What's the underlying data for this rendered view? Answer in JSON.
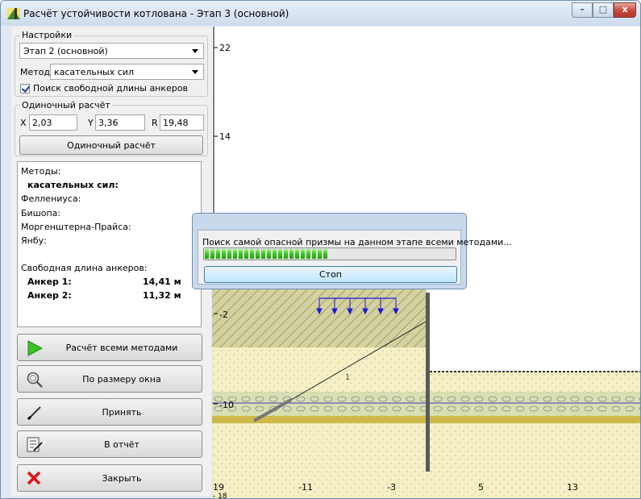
{
  "window": {
    "title": "Расчёт устойчивости котлована - Этап  3 (основной)",
    "controls": {
      "minimize": "–",
      "maximize": "□",
      "close": "x"
    }
  },
  "settings": {
    "group_label": "Настройки",
    "stage_value": "Этап  2 (основной)",
    "method_label": "Метод",
    "method_value": "касательных сил",
    "checkbox_label": "Поиск свободной длины анкеров",
    "checkbox_checked": true
  },
  "single_calc": {
    "group_label": "Одиночный расчёт",
    "x_label": "X",
    "x_value": "2,03",
    "y_label": "Y",
    "y_value": "3,36",
    "r_label": "R",
    "r_value": "19,48",
    "button_label": "Одиночный расчёт"
  },
  "results": {
    "methods_header": "Методы:",
    "methods": [
      "касательных сил:",
      "Феллениуса:",
      "Бишопа:",
      "Моргенштерна-Прайса:",
      "Янбу:"
    ],
    "anchors_header": "Свободная длина анкеров:",
    "anchors": [
      {
        "label": "Анкер 1:",
        "value": "14,41 м"
      },
      {
        "label": "Анкер 2:",
        "value": "11,32 м"
      }
    ]
  },
  "buttons": {
    "calc_all": "Расчёт всеми методами",
    "fit_window": "По размеру окна",
    "accept": "Принять",
    "to_report": "В отчёт",
    "close": "Закрыть"
  },
  "canvas": {
    "y_ticks": [
      "22",
      "14",
      "-2",
      "-10"
    ],
    "x_ticks": [
      "19",
      "-11",
      "-3",
      "5",
      "13"
    ],
    "x_origin_sub": "- 18",
    "slope_label": "1",
    "colors": {
      "soil_top": "#d9d6a8",
      "soil_sand": "#f5efc4",
      "hatch_green": "#a8b575",
      "clay_band": "#cfc86a",
      "wall": "#5a5a5a",
      "load": "#1a1ad6"
    }
  },
  "progress_dialog": {
    "message": "Поиск самой опасной призмы на данном этапе всеми методами...",
    "progress_fraction": 0.5,
    "stop_label": "Стоп"
  }
}
